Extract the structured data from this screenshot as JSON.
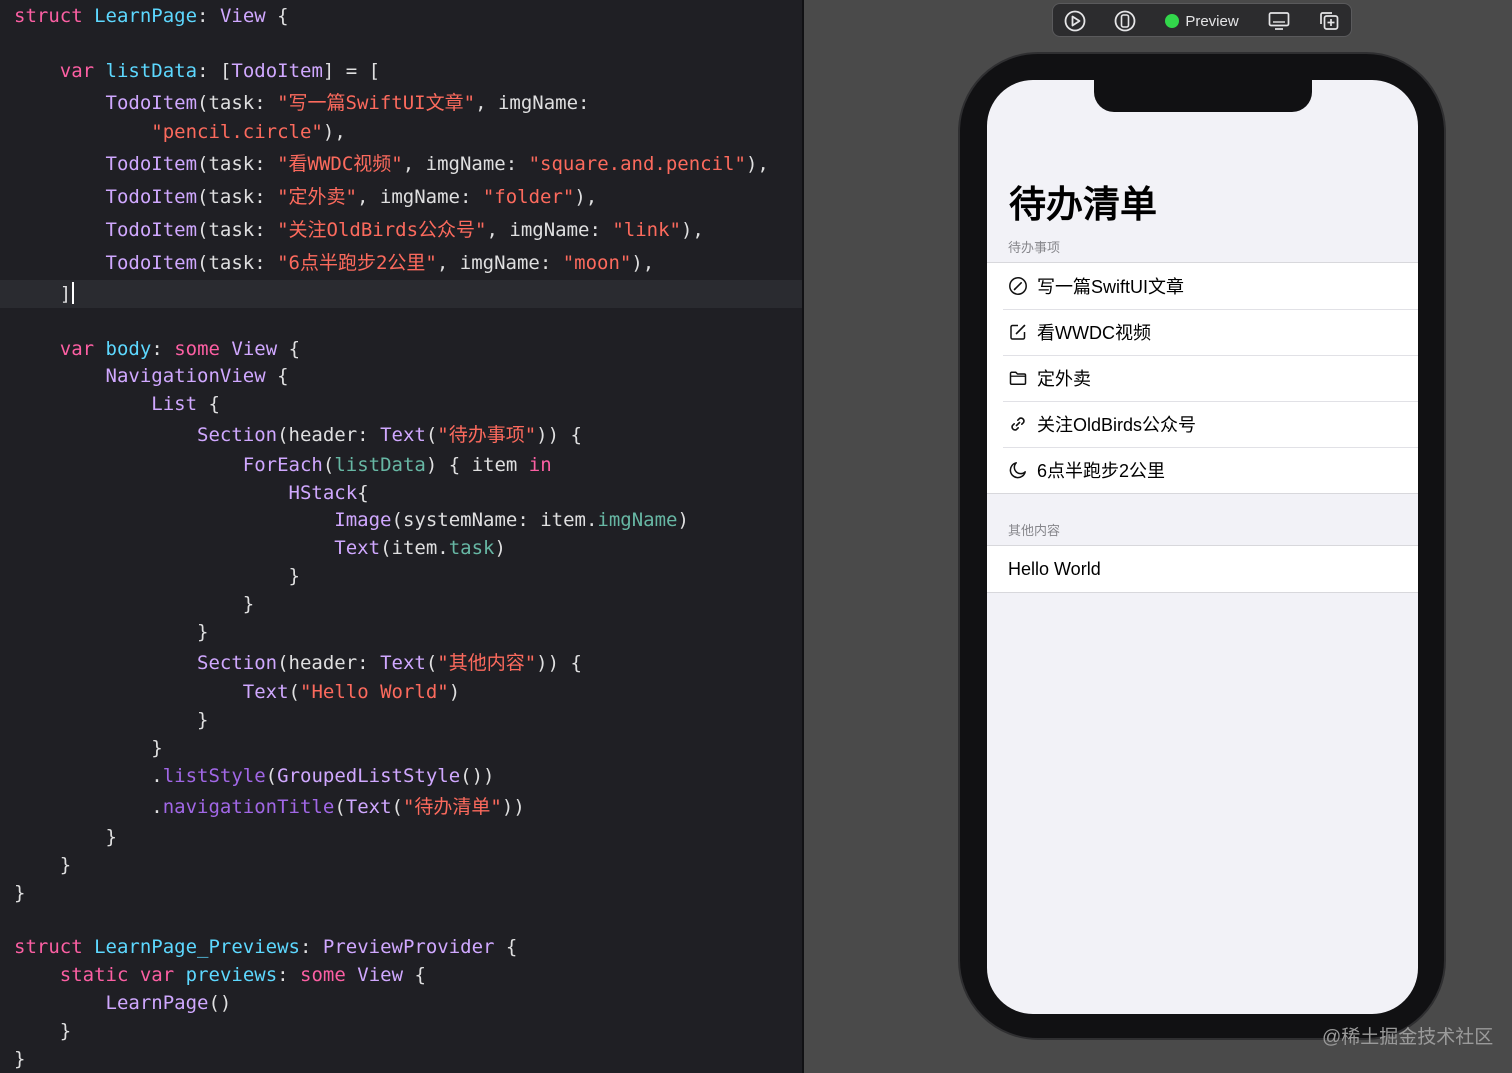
{
  "editor": {
    "lines": [
      [
        {
          "t": "struct",
          "c": "kw"
        },
        {
          "t": " ",
          "c": "pln"
        },
        {
          "t": "LearnPage",
          "c": "typ"
        },
        {
          "t": ": ",
          "c": "pln"
        },
        {
          "t": "View",
          "c": "ty2"
        },
        {
          "t": " {",
          "c": "pln"
        }
      ],
      [],
      [
        {
          "t": "    ",
          "c": "pln"
        },
        {
          "t": "var",
          "c": "kw"
        },
        {
          "t": " ",
          "c": "pln"
        },
        {
          "t": "listData",
          "c": "typ"
        },
        {
          "t": ": [",
          "c": "pln"
        },
        {
          "t": "TodoItem",
          "c": "ty2"
        },
        {
          "t": "] = [",
          "c": "pln"
        }
      ],
      [
        {
          "t": "        ",
          "c": "pln"
        },
        {
          "t": "TodoItem",
          "c": "ty2"
        },
        {
          "t": "(task: ",
          "c": "pln"
        },
        {
          "t": "\"写一篇SwiftUI文章\"",
          "c": "str"
        },
        {
          "t": ", imgName:",
          "c": "pln"
        }
      ],
      [
        {
          "t": "            ",
          "c": "pln"
        },
        {
          "t": "\"pencil.circle\"",
          "c": "str"
        },
        {
          "t": "),",
          "c": "pln"
        }
      ],
      [
        {
          "t": "        ",
          "c": "pln"
        },
        {
          "t": "TodoItem",
          "c": "ty2"
        },
        {
          "t": "(task: ",
          "c": "pln"
        },
        {
          "t": "\"看WWDC视频\"",
          "c": "str"
        },
        {
          "t": ", imgName: ",
          "c": "pln"
        },
        {
          "t": "\"square.and.pencil\"",
          "c": "str"
        },
        {
          "t": "),",
          "c": "pln"
        }
      ],
      [
        {
          "t": "        ",
          "c": "pln"
        },
        {
          "t": "TodoItem",
          "c": "ty2"
        },
        {
          "t": "(task: ",
          "c": "pln"
        },
        {
          "t": "\"定外卖\"",
          "c": "str"
        },
        {
          "t": ", imgName: ",
          "c": "pln"
        },
        {
          "t": "\"folder\"",
          "c": "str"
        },
        {
          "t": "),",
          "c": "pln"
        }
      ],
      [
        {
          "t": "        ",
          "c": "pln"
        },
        {
          "t": "TodoItem",
          "c": "ty2"
        },
        {
          "t": "(task: ",
          "c": "pln"
        },
        {
          "t": "\"关注OldBirds公众号\"",
          "c": "str"
        },
        {
          "t": ", imgName: ",
          "c": "pln"
        },
        {
          "t": "\"link\"",
          "c": "str"
        },
        {
          "t": "),",
          "c": "pln"
        }
      ],
      [
        {
          "t": "        ",
          "c": "pln"
        },
        {
          "t": "TodoItem",
          "c": "ty2"
        },
        {
          "t": "(task: ",
          "c": "pln"
        },
        {
          "t": "\"6点半跑步2公里\"",
          "c": "str"
        },
        {
          "t": ", imgName: ",
          "c": "pln"
        },
        {
          "t": "\"moon\"",
          "c": "str"
        },
        {
          "t": "),",
          "c": "pln"
        }
      ],
      [
        {
          "t": "    ]",
          "c": "pln"
        }
      ],
      [],
      [
        {
          "t": "    ",
          "c": "pln"
        },
        {
          "t": "var",
          "c": "kw"
        },
        {
          "t": " ",
          "c": "pln"
        },
        {
          "t": "body",
          "c": "typ"
        },
        {
          "t": ": ",
          "c": "pln"
        },
        {
          "t": "some",
          "c": "kw"
        },
        {
          "t": " ",
          "c": "pln"
        },
        {
          "t": "View",
          "c": "ty2"
        },
        {
          "t": " {",
          "c": "pln"
        }
      ],
      [
        {
          "t": "        ",
          "c": "pln"
        },
        {
          "t": "NavigationView",
          "c": "ty2"
        },
        {
          "t": " {",
          "c": "pln"
        }
      ],
      [
        {
          "t": "            ",
          "c": "pln"
        },
        {
          "t": "List",
          "c": "ty2"
        },
        {
          "t": " {",
          "c": "pln"
        }
      ],
      [
        {
          "t": "                ",
          "c": "pln"
        },
        {
          "t": "Section",
          "c": "ty2"
        },
        {
          "t": "(header: ",
          "c": "pln"
        },
        {
          "t": "Text",
          "c": "ty2"
        },
        {
          "t": "(",
          "c": "pln"
        },
        {
          "t": "\"待办事项\"",
          "c": "str"
        },
        {
          "t": ")) {",
          "c": "pln"
        }
      ],
      [
        {
          "t": "                    ",
          "c": "pln"
        },
        {
          "t": "ForEach",
          "c": "ty2"
        },
        {
          "t": "(",
          "c": "pln"
        },
        {
          "t": "listData",
          "c": "prop"
        },
        {
          "t": ") { item ",
          "c": "pln"
        },
        {
          "t": "in",
          "c": "kw"
        }
      ],
      [
        {
          "t": "                        ",
          "c": "pln"
        },
        {
          "t": "HStack",
          "c": "ty2"
        },
        {
          "t": "{",
          "c": "pln"
        }
      ],
      [
        {
          "t": "                            ",
          "c": "pln"
        },
        {
          "t": "Image",
          "c": "ty2"
        },
        {
          "t": "(systemName: item.",
          "c": "pln"
        },
        {
          "t": "imgName",
          "c": "prop"
        },
        {
          "t": ")",
          "c": "pln"
        }
      ],
      [
        {
          "t": "                            ",
          "c": "pln"
        },
        {
          "t": "Text",
          "c": "ty2"
        },
        {
          "t": "(item.",
          "c": "pln"
        },
        {
          "t": "task",
          "c": "prop"
        },
        {
          "t": ")",
          "c": "pln"
        }
      ],
      [
        {
          "t": "                        }",
          "c": "pln"
        }
      ],
      [
        {
          "t": "                    }",
          "c": "pln"
        }
      ],
      [
        {
          "t": "                }",
          "c": "pln"
        }
      ],
      [
        {
          "t": "                ",
          "c": "pln"
        },
        {
          "t": "Section",
          "c": "ty2"
        },
        {
          "t": "(header: ",
          "c": "pln"
        },
        {
          "t": "Text",
          "c": "ty2"
        },
        {
          "t": "(",
          "c": "pln"
        },
        {
          "t": "\"其他内容\"",
          "c": "str"
        },
        {
          "t": ")) {",
          "c": "pln"
        }
      ],
      [
        {
          "t": "                    ",
          "c": "pln"
        },
        {
          "t": "Text",
          "c": "ty2"
        },
        {
          "t": "(",
          "c": "pln"
        },
        {
          "t": "\"Hello World\"",
          "c": "str"
        },
        {
          "t": ")",
          "c": "pln"
        }
      ],
      [
        {
          "t": "                }",
          "c": "pln"
        }
      ],
      [
        {
          "t": "            }",
          "c": "pln"
        }
      ],
      [
        {
          "t": "            .",
          "c": "pln"
        },
        {
          "t": "listStyle",
          "c": "fn"
        },
        {
          "t": "(",
          "c": "pln"
        },
        {
          "t": "GroupedListStyle",
          "c": "ty2"
        },
        {
          "t": "())",
          "c": "pln"
        }
      ],
      [
        {
          "t": "            .",
          "c": "pln"
        },
        {
          "t": "navigationTitle",
          "c": "fn"
        },
        {
          "t": "(",
          "c": "pln"
        },
        {
          "t": "Text",
          "c": "ty2"
        },
        {
          "t": "(",
          "c": "pln"
        },
        {
          "t": "\"待办清单\"",
          "c": "str"
        },
        {
          "t": "))",
          "c": "pln"
        }
      ],
      [
        {
          "t": "        }",
          "c": "pln"
        }
      ],
      [
        {
          "t": "    }",
          "c": "pln"
        }
      ],
      [
        {
          "t": "}",
          "c": "pln"
        }
      ],
      [],
      [
        {
          "t": "struct",
          "c": "kw"
        },
        {
          "t": " ",
          "c": "pln"
        },
        {
          "t": "LearnPage_Previews",
          "c": "typ"
        },
        {
          "t": ": ",
          "c": "pln"
        },
        {
          "t": "PreviewProvider",
          "c": "ty2"
        },
        {
          "t": " {",
          "c": "pln"
        }
      ],
      [
        {
          "t": "    ",
          "c": "pln"
        },
        {
          "t": "static",
          "c": "kw"
        },
        {
          "t": " ",
          "c": "pln"
        },
        {
          "t": "var",
          "c": "kw"
        },
        {
          "t": " ",
          "c": "pln"
        },
        {
          "t": "previews",
          "c": "typ"
        },
        {
          "t": ": ",
          "c": "pln"
        },
        {
          "t": "some",
          "c": "kw"
        },
        {
          "t": " ",
          "c": "pln"
        },
        {
          "t": "View",
          "c": "ty2"
        },
        {
          "t": " {",
          "c": "pln"
        }
      ],
      [
        {
          "t": "        ",
          "c": "pln"
        },
        {
          "t": "LearnPage",
          "c": "ty2"
        },
        {
          "t": "()",
          "c": "pln"
        }
      ],
      [
        {
          "t": "    }",
          "c": "pln"
        }
      ],
      [
        {
          "t": "}",
          "c": "pln"
        }
      ]
    ],
    "current_line": 9,
    "colors": {
      "keyword": "#fc5fa3",
      "type": "#5dd8ff",
      "class": "#d0a8ff",
      "method": "#a167e6",
      "property": "#67b7a4",
      "string": "#fc6a5d",
      "plain": "#dfdfe0",
      "background": "#1f1f24"
    }
  },
  "preview_toolbar": {
    "buttons": [
      {
        "name": "live-preview-icon"
      },
      {
        "name": "device-preview-icon"
      },
      {
        "name": "preview-toggle",
        "label": "Preview"
      },
      {
        "name": "device-settings-icon"
      },
      {
        "name": "duplicate-preview-icon"
      }
    ],
    "preview_label": "Preview",
    "accent": "#32d74b"
  },
  "phone": {
    "nav_title": "待办清单",
    "sections": [
      {
        "header": "待办事项",
        "rows": [
          {
            "icon": "pencil-circle-icon",
            "text": "写一篇SwiftUI文章"
          },
          {
            "icon": "square-and-pencil-icon",
            "text": "看WWDC视频"
          },
          {
            "icon": "folder-icon",
            "text": "定外卖"
          },
          {
            "icon": "link-icon",
            "text": "关注OldBirds公众号"
          },
          {
            "icon": "moon-icon",
            "text": "6点半跑步2公里"
          }
        ]
      },
      {
        "header": "其他内容",
        "rows": [
          {
            "text": "Hello World"
          }
        ]
      }
    ]
  },
  "watermark": "@稀土掘金技术社区"
}
